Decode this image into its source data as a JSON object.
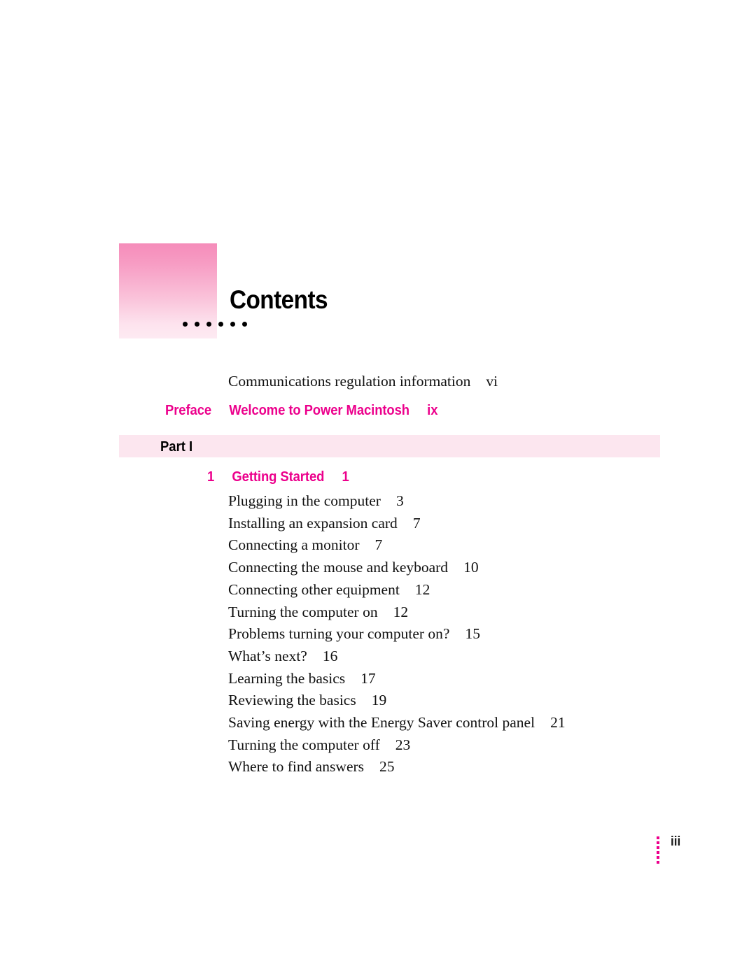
{
  "page": {
    "title": "Contents",
    "folio": "iii",
    "folio_dot_count": 6,
    "header_dot_count": 6,
    "accent_color": "#ec008c",
    "band_color": "#fce6ef",
    "block_gradient_top": "#f58cba",
    "block_gradient_bottom": "#fdeaf2"
  },
  "front_matter": {
    "label": "Communications regulation information",
    "page": "vi"
  },
  "preface": {
    "kicker": "Preface",
    "title": "Welcome to Power Macintosh",
    "page": "ix"
  },
  "part": {
    "label": "Part I"
  },
  "chapter": {
    "number": "1",
    "title": "Getting Started",
    "page": "1"
  },
  "entries": [
    {
      "label": "Plugging in the computer",
      "page": "3"
    },
    {
      "label": "Installing an expansion card",
      "page": "7"
    },
    {
      "label": "Connecting a monitor",
      "page": "7"
    },
    {
      "label": "Connecting the mouse and keyboard",
      "page": "10"
    },
    {
      "label": "Connecting other equipment",
      "page": "12"
    },
    {
      "label": "Turning the computer on",
      "page": "12"
    },
    {
      "label": "Problems turning your computer on?",
      "page": "15"
    },
    {
      "label": "What’s next?",
      "page": "16"
    },
    {
      "label": "Learning the basics",
      "page": "17"
    },
    {
      "label": "Reviewing the basics",
      "page": "19"
    },
    {
      "label": "Saving energy with the Energy Saver control panel",
      "page": "21"
    },
    {
      "label": "Turning the computer off",
      "page": "23"
    },
    {
      "label": "Where to find answers",
      "page": "25"
    }
  ]
}
